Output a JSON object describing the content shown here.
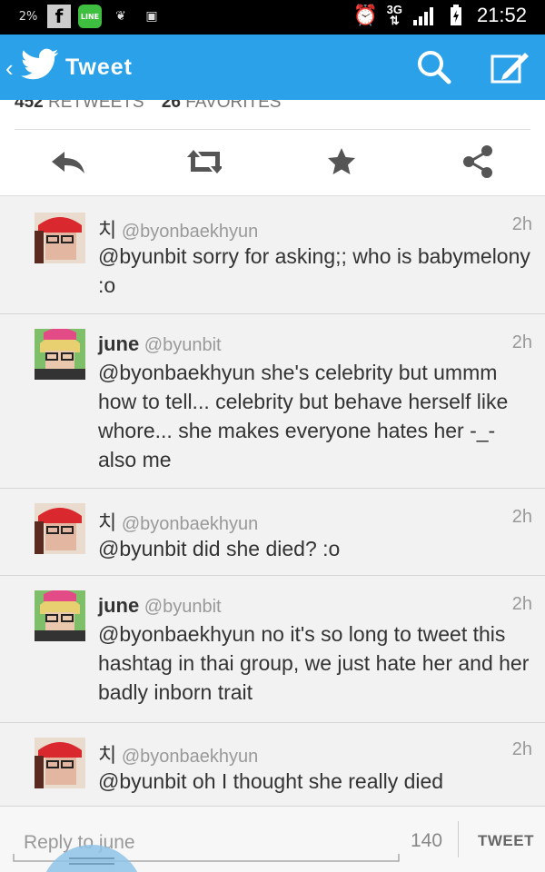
{
  "status_bar": {
    "battery_small": "2%",
    "network": "3G",
    "time": "21:52"
  },
  "app_bar": {
    "title": "Tweet",
    "icons": [
      "back-chevron-icon",
      "twitter-bird-icon",
      "search-icon",
      "compose-icon"
    ]
  },
  "stats": {
    "retweets_count": "452",
    "retweets_label": "RETWEETS",
    "favorites_count": "26",
    "favorites_label": "FAVORITES"
  },
  "actions": [
    "reply-icon",
    "retweet-icon",
    "favorite-icon",
    "share-icon"
  ],
  "tweets": [
    {
      "name": "치",
      "handle": "@byonbaekhyun",
      "time": "2h",
      "text": "@byunbit sorry for asking;; who is babymelony :o"
    },
    {
      "name": "june",
      "handle": "@byunbit",
      "time": "2h",
      "text": "@byonbaekhyun she's celebrity but ummm how to tell... celebrity but behave herself like whore... she makes everyone hates her -_- also me"
    },
    {
      "name": "치",
      "handle": "@byonbaekhyun",
      "time": "2h",
      "text": "@byunbit did she died? :o"
    },
    {
      "name": "june",
      "handle": "@byunbit",
      "time": "2h",
      "text": "@byonbaekhyun no it's so long to tweet this hashtag in thai group, we just hate her and her badly inborn trait"
    },
    {
      "name": "치",
      "handle": "@byonbaekhyun",
      "time": "2h",
      "text": "@byunbit oh I thought she really died"
    }
  ],
  "reply": {
    "placeholder": "Reply to june",
    "char_count": "140",
    "send_label": "TWEET"
  },
  "colors": {
    "accent": "#2aa1e8",
    "status_bar": "#000000"
  }
}
